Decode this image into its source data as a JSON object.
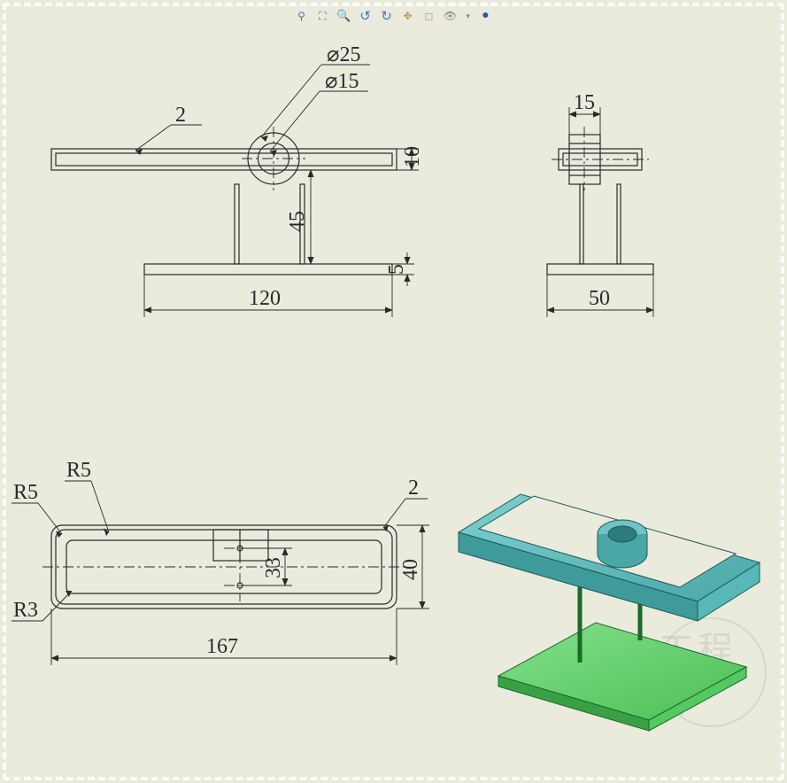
{
  "toolbar": {
    "items": [
      {
        "name": "zoom-area-icon",
        "glyph": "⚲"
      },
      {
        "name": "zoom-fit-icon",
        "glyph": "⛶"
      },
      {
        "name": "zoom-in-icon",
        "glyph": "🔍"
      },
      {
        "name": "rotate-ccw-icon",
        "glyph": "↺"
      },
      {
        "name": "rotate-cw-icon",
        "glyph": "↻"
      },
      {
        "name": "pan-icon",
        "glyph": "✥"
      },
      {
        "name": "view-cube-icon",
        "glyph": "◻"
      },
      {
        "name": "visibility-icon",
        "glyph": "👁"
      },
      {
        "name": "dropdown-icon",
        "glyph": "▾"
      },
      {
        "name": "render-icon",
        "glyph": "●"
      }
    ]
  },
  "views": {
    "front": {
      "dims": {
        "diameter_outer": "⌀25",
        "diameter_inner": "⌀15",
        "frame_thickness": "2",
        "frame_height": "10",
        "stand_height": "45",
        "base_thickness": "5",
        "base_width": "120"
      }
    },
    "side": {
      "dims": {
        "hub_width": "15",
        "base_depth": "50"
      }
    },
    "top": {
      "dims": {
        "outer_fillet": "R5",
        "inner_fillet": "R5",
        "slot_fillet": "R3",
        "frame_thickness": "2",
        "pin_spacing": "33",
        "depth": "40",
        "length": "167"
      }
    }
  },
  "watermark": "工程师"
}
